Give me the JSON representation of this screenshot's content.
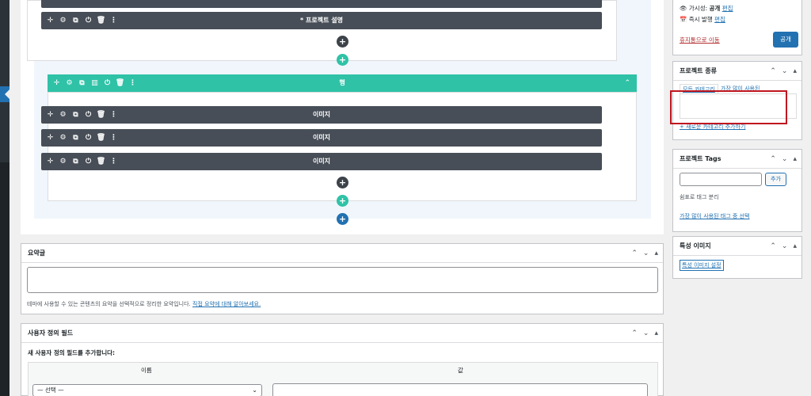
{
  "builder": {
    "top_module_title": "* 프로젝트 설명",
    "row_title": "행",
    "modules": [
      {
        "title": "이미지"
      },
      {
        "title": "이미지"
      },
      {
        "title": "이미지"
      }
    ],
    "icons": {
      "move": "✛",
      "settings": "⚙",
      "duplicate": "⧉",
      "power": "⏻",
      "trash": "🗑",
      "more": "⋮",
      "columns": "▥",
      "chevron_up": "⌃"
    },
    "plus": "+"
  },
  "excerpt": {
    "title": "요약글",
    "help_text": "테마에 사용할 수 있는 콘텐츠의 요약을 선택적으로 정리한 요약입니다. ",
    "help_link": "직접 요약에 대해 알아보세요."
  },
  "custom_fields": {
    "title": "사용자 정의 필드",
    "add_new_label": "새 사용자 정의 필드를 추가합니다:",
    "col_name": "이름",
    "col_value": "값",
    "select_placeholder": "— 선택 —"
  },
  "publish": {
    "visibility_label": "가시성: ",
    "visibility_value": "공개",
    "visibility_edit": "편집",
    "schedule_label": "즉시 발행",
    "schedule_edit": "편집",
    "trash_link": "휴지통으로 이동",
    "publish_button": "공개"
  },
  "project_type": {
    "title": "프로젝트 종류",
    "tab_all": "모든 카테고리",
    "tab_popular": "가장 많이 사용된",
    "add_new": "+ 새로운 카테고리 추가하기"
  },
  "project_tags": {
    "title": "프로젝트 Tags",
    "add_button": "추가",
    "hint": "쉼표로 태그 분리",
    "choose_link": "가장 많이 사용된 태그 중 선택"
  },
  "featured_image": {
    "title": "특성 이미지",
    "set_link": "특성 이미지 설정"
  },
  "panel_controls": {
    "up": "⌃",
    "down": "⌄",
    "toggle": "▴"
  },
  "colors": {
    "row_accent": "#2fc2a7",
    "module_bg": "#474e57",
    "primary": "#2271b1",
    "highlight": "#c0161f"
  }
}
